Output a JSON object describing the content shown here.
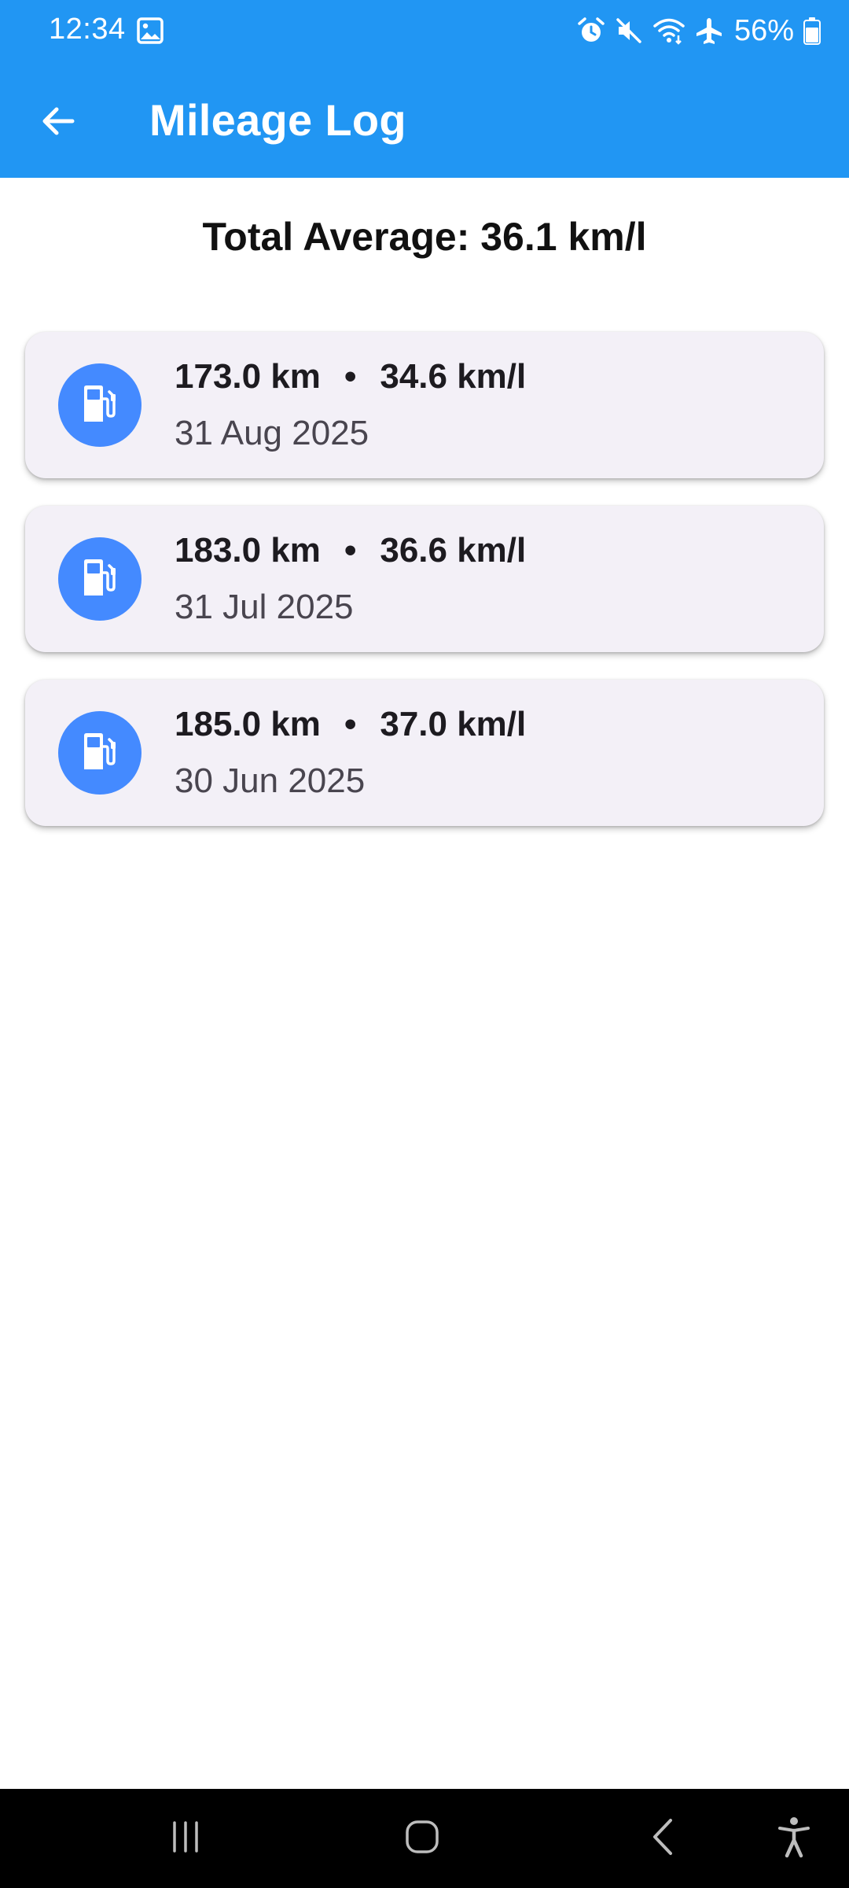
{
  "status_bar": {
    "time": "12:34",
    "battery_percent": "56%",
    "icons": [
      "image-icon",
      "alarm-icon",
      "mute-icon",
      "wifi-icon",
      "airplane-icon",
      "battery-icon"
    ]
  },
  "app_bar": {
    "title": "Mileage Log",
    "back_icon": "arrow-back-icon"
  },
  "summary": {
    "total_average": "Total Average: 36.1 km/l"
  },
  "log_entries": [
    {
      "distance": "173.0 km",
      "separator": "•",
      "mileage": "34.6 km/l",
      "date": "31 Aug 2025",
      "icon": "fuel-pump-icon"
    },
    {
      "distance": "183.0 km",
      "separator": "•",
      "mileage": "36.6 km/l",
      "date": "31 Jul 2025",
      "icon": "fuel-pump-icon"
    },
    {
      "distance": "185.0 km",
      "separator": "•",
      "mileage": "37.0 km/l",
      "date": "30 Jun 2025",
      "icon": "fuel-pump-icon"
    }
  ],
  "nav_bar": {
    "buttons": [
      "recent-apps-icon",
      "home-icon",
      "back-icon",
      "accessibility-icon"
    ]
  },
  "colors": {
    "app_bar": "#2196F3",
    "avatar": "#448AFF",
    "card": "#F3F0F7",
    "nav_bar": "#000000"
  }
}
